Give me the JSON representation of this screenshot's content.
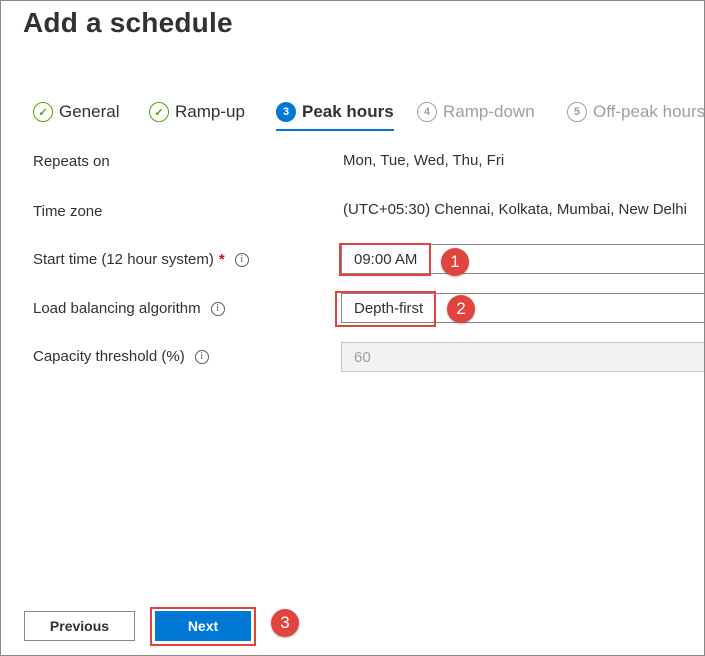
{
  "page": {
    "title": "Add a schedule"
  },
  "tabs": [
    {
      "label": "General",
      "state": "done",
      "marker": "✓"
    },
    {
      "label": "Ramp-up",
      "state": "done",
      "marker": "✓"
    },
    {
      "label": "Peak hours",
      "state": "active",
      "marker": "3"
    },
    {
      "label": "Ramp-down",
      "state": "disabled",
      "marker": "4"
    },
    {
      "label": "Off-peak hours",
      "state": "disabled",
      "marker": "5"
    }
  ],
  "form": {
    "repeats_on": {
      "label": "Repeats on",
      "value": "Mon, Tue, Wed, Thu, Fri"
    },
    "time_zone": {
      "label": "Time zone",
      "value": "(UTC+05:30) Chennai, Kolkata, Mumbai, New Delhi"
    },
    "start_time": {
      "label": "Start time (12 hour system)",
      "required_mark": "*",
      "value": "09:00 AM"
    },
    "load_balancing": {
      "label": "Load balancing algorithm",
      "value": "Depth-first"
    },
    "capacity_threshold": {
      "label": "Capacity threshold (%)",
      "value": "60"
    }
  },
  "info_icon_glyph": "i",
  "callouts": [
    "1",
    "2",
    "3"
  ],
  "buttons": {
    "previous": "Previous",
    "next": "Next"
  },
  "colors": {
    "accent": "#0078d4",
    "success": "#57a300",
    "callout": "#e0443f",
    "required": "#c50f1f"
  }
}
